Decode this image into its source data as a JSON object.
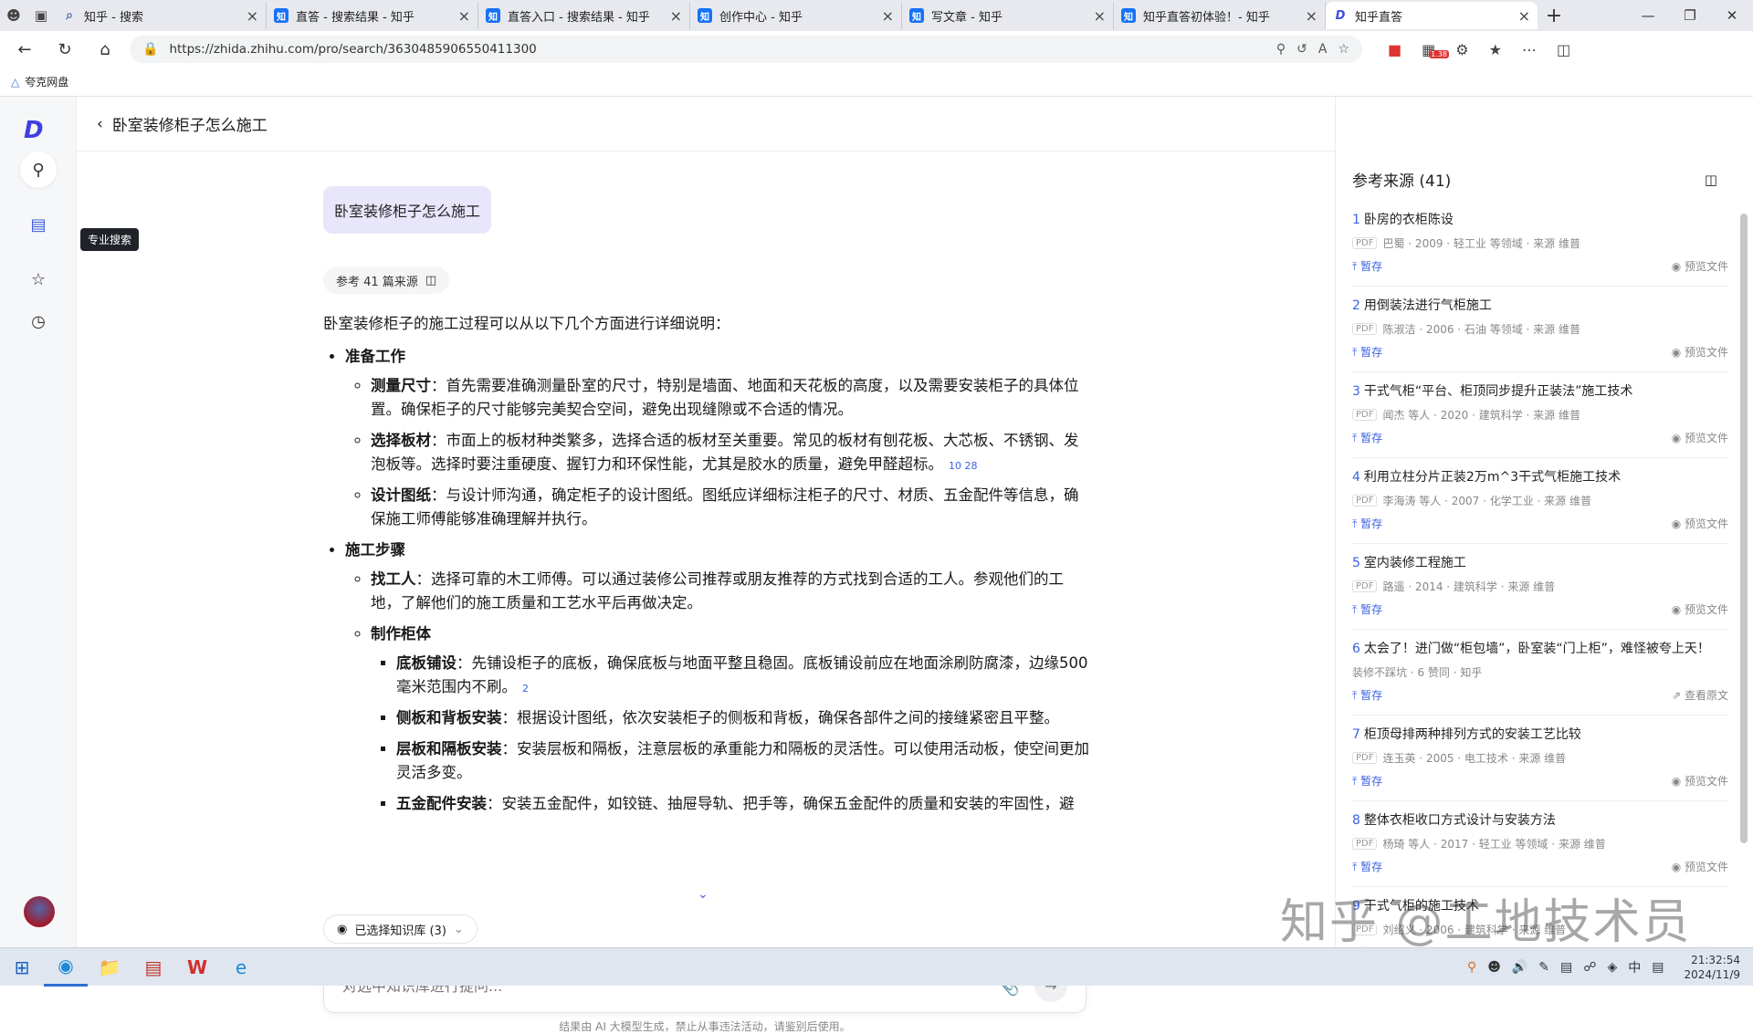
{
  "browser": {
    "tabs": [
      {
        "label": "知乎 - 搜索",
        "icon": "search"
      },
      {
        "label": "直答 - 搜索结果 - 知乎",
        "icon": "知"
      },
      {
        "label": "直答入口 - 搜索结果 - 知乎",
        "icon": "知"
      },
      {
        "label": "创作中心 - 知乎",
        "icon": "知"
      },
      {
        "label": "写文章 - 知乎",
        "icon": "知"
      },
      {
        "label": "知乎直答初体验！- 知乎",
        "icon": "知"
      },
      {
        "label": "知乎直答",
        "icon": "D"
      }
    ],
    "url": "https://zhida.zhihu.com/pro/search/3630485906550411300",
    "bookmark": "夸克网盘",
    "ext_badge": "1.38"
  },
  "sidebar": {
    "logo": "D",
    "tooltip": "专业搜索"
  },
  "page": {
    "question_title": "卧室装修柜子怎么施工",
    "user_question": "卧室装修柜子怎么施工",
    "sources_pill": "参考 41 篇来源",
    "intro": "卧室装修柜子的施工过程可以从以下几个方面进行详细说明：",
    "sections": [
      {
        "title": "准备工作",
        "items": [
          {
            "term": "测量尺寸",
            "text": "：首先需要准确测量卧室的尺寸，特别是墙面、地面和天花板的高度，以及需要安装柜子的具体位置。确保柜子的尺寸能够完美契合空间，避免出现缝隙或不合适的情况。",
            "cite": ""
          },
          {
            "term": "选择板材",
            "text": "：市面上的板材种类繁多，选择合适的板材至关重要。常见的板材有刨花板、大芯板、不锈钢、发泡板等。选择时要注重硬度、握钉力和环保性能，尤其是胶水的质量，避免甲醛超标。",
            "cite": "10  28"
          },
          {
            "term": "设计图纸",
            "text": "：与设计师沟通，确定柜子的设计图纸。图纸应详细标注柜子的尺寸、材质、五金配件等信息，确保施工师傅能够准确理解并执行。",
            "cite": ""
          }
        ]
      },
      {
        "title": "施工步骤",
        "items": [
          {
            "term": "找工人",
            "text": "：选择可靠的木工师傅。可以通过装修公司推荐或朋友推荐的方式找到合适的工人。参观他们的工地，了解他们的施工质量和工艺水平后再做决定。",
            "cite": ""
          }
        ],
        "sub": {
          "title": "制作柜体",
          "items": [
            {
              "term": "底板铺设",
              "text": "：先铺设柜子的底板，确保底板与地面平整且稳固。底板铺设前应在地面涂刷防腐漆，边缘500毫米范围内不刷。",
              "cite": "2"
            },
            {
              "term": "侧板和背板安装",
              "text": "：根据设计图纸，依次安装柜子的侧板和背板，确保各部件之间的接缝紧密且平整。",
              "cite": ""
            },
            {
              "term": "层板和隔板安装",
              "text": "：安装层板和隔板，注意层板的承重能力和隔板的灵活性。可以使用活动板，使空间更加灵活多变。",
              "cite": ""
            },
            {
              "term": "五金配件安装",
              "text": "：安装五金配件，如铰链、抽屉导轨、把手等，确保五金配件的质量和安装的牢固性，避",
              "cite": ""
            }
          ]
        }
      }
    ],
    "kb_selector": "已选择知识库 (3)",
    "input_placeholder": "对选中知识库进行提问...",
    "disclaimer": "结果由 AI 大模型生成，禁止从事违法活动，请鉴别后使用。"
  },
  "refs": {
    "title": "参考来源 (41)",
    "pause_label": "暂存",
    "items": [
      {
        "n": "1",
        "title": "卧房的衣柜陈设",
        "pdf": true,
        "meta": "巴蜀 · 2009 · 轻工业 等领域 · 来源 维普",
        "action": "预览文件"
      },
      {
        "n": "2",
        "title": "用倒装法进行气柜施工",
        "pdf": true,
        "meta": "陈淑洁 · 2006 · 石油 等领域 · 来源 维普",
        "action": "预览文件"
      },
      {
        "n": "3",
        "title": "干式气柜“平台、柜顶同步提升正装法”施工技术",
        "pdf": true,
        "meta": "闻杰 等人 · 2020 · 建筑科学 · 来源 维普",
        "action": "预览文件"
      },
      {
        "n": "4",
        "title": "利用立柱分片正装2万m^3干式气柜施工技术",
        "pdf": true,
        "meta": "李海涛 等人 · 2007 · 化学工业 · 来源 维普",
        "action": "预览文件"
      },
      {
        "n": "5",
        "title": "室内装修工程施工",
        "pdf": true,
        "meta": "路遥 · 2014 · 建筑科学 · 来源 维普",
        "action": "预览文件"
      },
      {
        "n": "6",
        "title": "太会了！进门做“柜包墙”，卧室装“门上柜”，难怪被夸上天！",
        "pdf": false,
        "meta": "装修不踩坑 · 6 赞同 · 知乎",
        "action": "查看原文"
      },
      {
        "n": "7",
        "title": "柜顶母排两种排列方式的安装工艺比较",
        "pdf": true,
        "meta": "连玉英 · 2005 · 电工技术 · 来源 维普",
        "action": "预览文件"
      },
      {
        "n": "8",
        "title": "整体衣柜收口方式设计与安装方法",
        "pdf": true,
        "meta": "杨琦 等人 · 2017 · 轻工业 等领域 · 来源 维普",
        "action": "预览文件"
      },
      {
        "n": "9",
        "title": "干式气柜的施工技术",
        "pdf": true,
        "meta": "刘绍义 · 2006 · 建筑科学 · 来源 维普",
        "action": "预览文件"
      }
    ]
  },
  "watermark": "知乎 @工地技术员",
  "taskbar": {
    "time": "21:32:54",
    "date": "2024/11/9"
  }
}
